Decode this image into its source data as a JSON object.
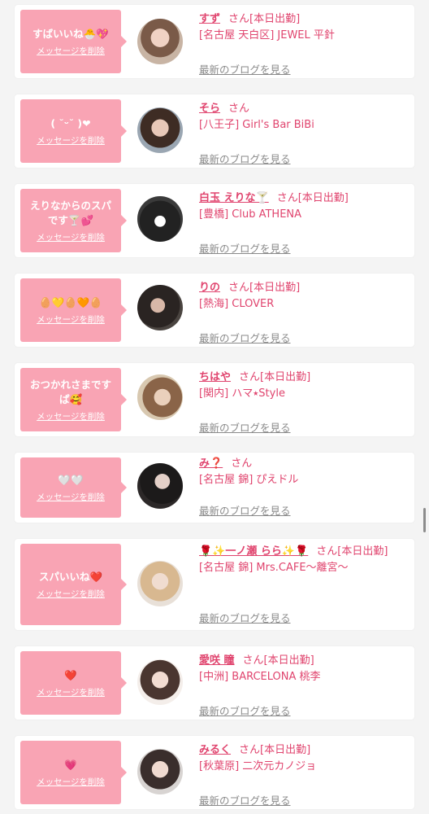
{
  "delete_label": "メッセージを削除",
  "blog_label": "最新のブログを見る",
  "colors": {
    "bubble": "#f9a4b4",
    "name": "#e0446e",
    "link": "#8a8a8a"
  },
  "items": [
    {
      "message": "すばいいね🐣💖",
      "name": "すず",
      "san": "さん[本日出勤]",
      "shop": "[名古屋 天白区] JEWEL 平針"
    },
    {
      "message": "( ˘ᵕ˘ )❤",
      "name": "そら",
      "san": "さん",
      "shop": "[八王子] Girl's Bar BiBi"
    },
    {
      "message": "えりなからのスパです🍸💕",
      "name": "白玉 えりな🍸",
      "san": "さん[本日出勤]",
      "shop": "[豊橋] Club ATHENA"
    },
    {
      "message": "🥚💛🥚🧡🥚",
      "name": "りの",
      "san": "さん[本日出勤]",
      "shop": "[熱海] CLOVER"
    },
    {
      "message": "おつかれさまですぱ🥰",
      "name": "ちはや",
      "san": "さん[本日出勤]",
      "shop": "[関内] ハマ⭑Style"
    },
    {
      "message": "🤍🤍",
      "name": "み❓",
      "san": "さん",
      "shop": "[名古屋 錦] ぴえドル"
    },
    {
      "message": "スパいいね❤️",
      "name": "🌹✨一ノ瀬 らら✨🌹",
      "san": "さん[本日出勤]",
      "shop": "[名古屋 錦] Mrs.CAFE〜離宮〜"
    },
    {
      "message": "❤️",
      "name": "愛咲 瞳",
      "san": "さん[本日出勤]",
      "shop": "[中洲] BARCELONA 桃李"
    },
    {
      "message": "💗",
      "name": "みるく",
      "san": "さん[本日出勤]",
      "shop": "[秋葉原] 二次元カノジョ"
    }
  ]
}
